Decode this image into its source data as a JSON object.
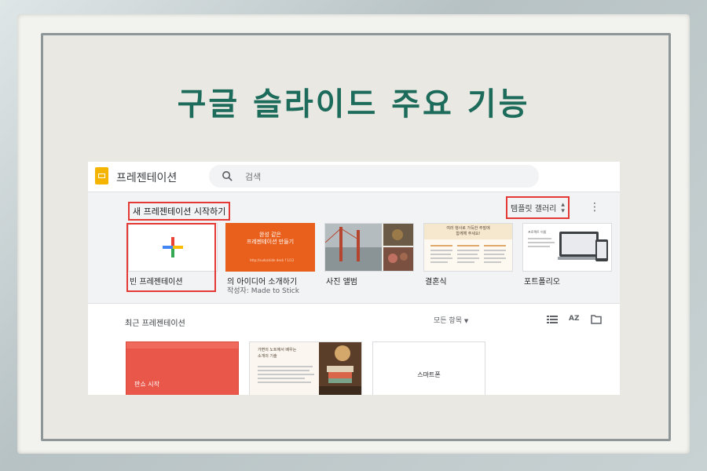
{
  "headline": "구글 슬라이드 주요 기능",
  "app": {
    "title": "프레젠테이션",
    "logo_color": "#f4b400"
  },
  "search": {
    "placeholder": "검색"
  },
  "start": {
    "label": "새 프레젠테이션 시작하기",
    "gallery_label": "템플릿 갤러리",
    "templates": [
      {
        "name": "빈 프레젠테이션"
      },
      {
        "name": "의 아이디어 소개하기",
        "author": "작성자: Made to Stick",
        "thumb_title": "완성 같은\n프레젠테이션 만들기",
        "thumb_footer": "http://sudo/slide deck f 1/12",
        "color": "#e8601c"
      },
      {
        "name": "사진 앨범"
      },
      {
        "name": "결혼식",
        "thumb_title": "여러 행사로 가득한 주말에\n함께해 주세요!",
        "color": "#f6e7cf"
      },
      {
        "name": "포트폴리오",
        "thumb_title": "프로젝트 이름"
      }
    ]
  },
  "recent": {
    "title": "최근 프레젠테이션",
    "owner_filter": "모든 항목",
    "docs": [
      {
        "title": "판쇼 시작",
        "color": "#e8574a"
      },
      {
        "title": "가변의 노트에서 배우는\n소개의 기술",
        "color": "#fbf7f0"
      },
      {
        "title": "스마트폰"
      }
    ]
  },
  "colors": {
    "accent_red": "#e53935",
    "headline_green": "#1d6b5a"
  }
}
